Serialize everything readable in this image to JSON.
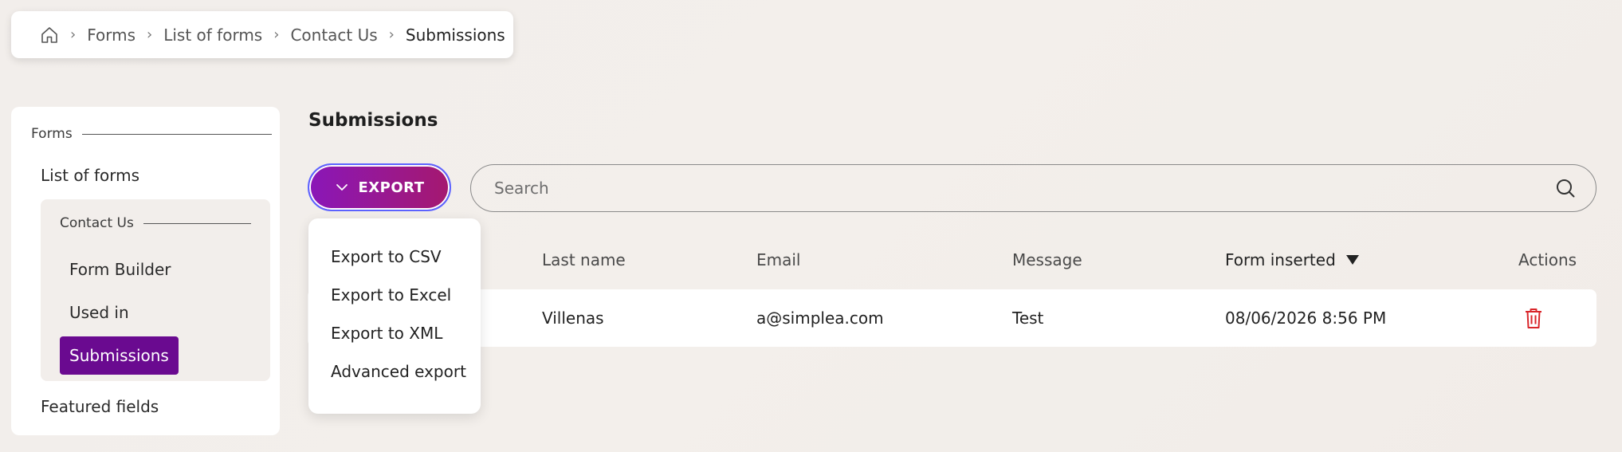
{
  "breadcrumb": {
    "items": [
      "Forms",
      "List of forms",
      "Contact Us",
      "Submissions"
    ]
  },
  "sidebar": {
    "section_label": "Forms",
    "list_of_forms": "List of forms",
    "sub_section_label": "Contact Us",
    "sub_items": [
      "Form Builder",
      "Used in",
      "Submissions"
    ],
    "active_item": "Submissions",
    "featured_fields": "Featured fields"
  },
  "main": {
    "title": "Submissions",
    "export_label": "EXPORT",
    "search": {
      "placeholder": "Search",
      "value": ""
    },
    "export_menu": [
      "Export to CSV",
      "Export to Excel",
      "Export to XML",
      "Advanced export"
    ],
    "table": {
      "columns": [
        "Last name",
        "Email",
        "Message",
        "Form inserted",
        "Actions"
      ],
      "sorted_column": "Form inserted",
      "sort_direction": "desc",
      "rows": [
        {
          "last_name": "Villenas",
          "email": "a@simplea.com",
          "message": "Test",
          "form_inserted": "08/06/2026 8:56 PM"
        }
      ]
    }
  },
  "colors": {
    "accent": "#6a0a90",
    "export_gradient_start": "#8a17b8",
    "export_gradient_end": "#a5186f",
    "delete": "#d9262b"
  },
  "icons": {
    "home": "home-icon",
    "search": "search-icon",
    "chevron": "chevron-down-icon",
    "sort": "sort-desc-icon",
    "delete": "trash-icon"
  }
}
